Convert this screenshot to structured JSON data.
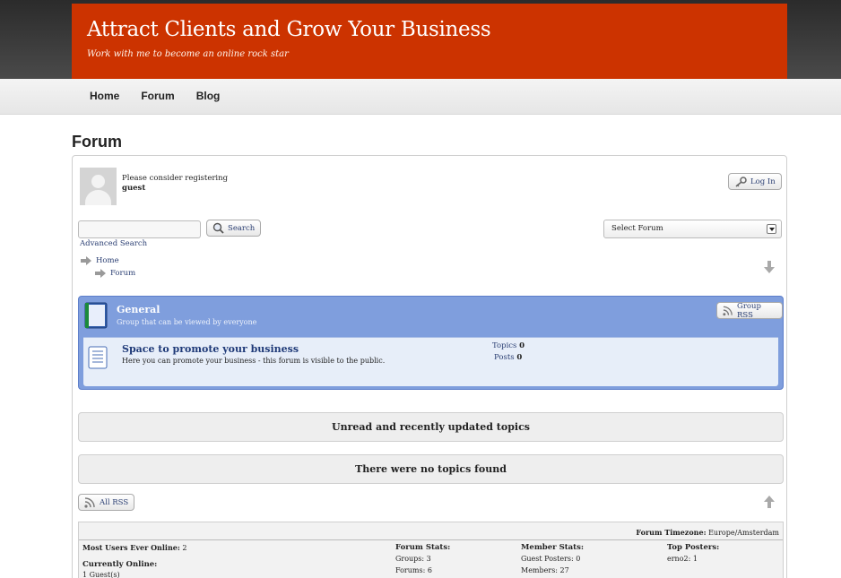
{
  "site": {
    "title": "Attract Clients and Grow Your Business",
    "tagline": "Work with me to become an online rock star",
    "brand_color": "#cc3300"
  },
  "nav": {
    "items": [
      "Home",
      "Forum",
      "Blog"
    ]
  },
  "page": {
    "title": "Forum"
  },
  "user": {
    "message": "Please consider registering",
    "name": "guest",
    "avatar_icon": "default-avatar-icon"
  },
  "toolbar": {
    "login_label": "Log In",
    "search_label": "Search",
    "search_placeholder": "",
    "advanced_search": "Advanced Search",
    "select_forum": "Select Forum"
  },
  "breadcrumb": [
    "Home",
    "Forum"
  ],
  "group": {
    "title": "General",
    "description": "Group that can be viewed by everyone",
    "rss_label": "Group RSS",
    "color": "#7f9edd"
  },
  "forum": {
    "name": "Space to promote your business",
    "description": "Here you can promote your business - this forum is visible to the public.",
    "topics_label": "Topics",
    "topics_count": "0",
    "posts_label": "Posts",
    "posts_count": "0"
  },
  "bars": {
    "unread": "Unread and recently updated topics",
    "no_topics": "There were no topics found"
  },
  "all_rss": "All RSS",
  "stats": {
    "timezone_label": "Forum Timezone:",
    "timezone_value": "Europe/Amsterdam",
    "most_users_label": "Most Users Ever Online:",
    "most_users_value": "2",
    "currently_online_label": "Currently Online:",
    "guests": "1 Guest(s)",
    "forum_stats_label": "Forum Stats:",
    "groups": "Groups: 3",
    "forums": "Forums: 6",
    "member_stats_label": "Member Stats:",
    "guest_posters": "Guest Posters: 0",
    "members": "Members: 27",
    "top_posters_label": "Top Posters:",
    "top_poster": "erno2: 1"
  }
}
